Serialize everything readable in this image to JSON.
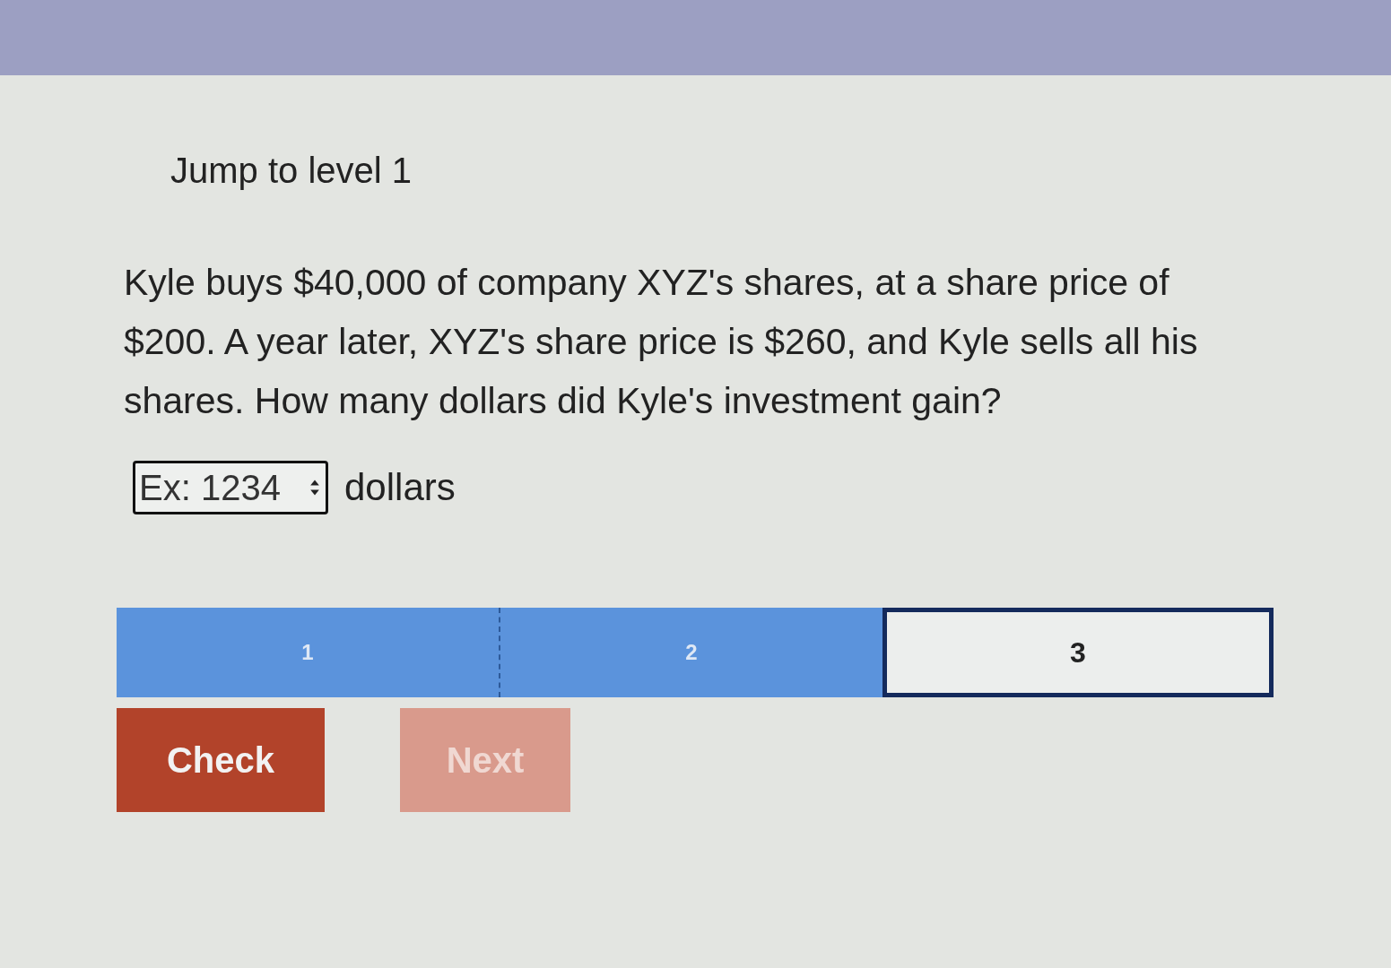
{
  "heading": "Jump to level 1",
  "question": "Kyle buys $40,000 of company XYZ's shares, at a share price of $200. A year later, XYZ's share price is $260, and Kyle sells all his shares. How many dollars did Kyle's investment gain?",
  "answer": {
    "placeholder": "Ex: 1234",
    "unit": "dollars"
  },
  "levels": [
    {
      "label": "1",
      "completed": true,
      "selected": false
    },
    {
      "label": "2",
      "completed": true,
      "selected": false
    },
    {
      "label": "3",
      "completed": false,
      "selected": true
    }
  ],
  "buttons": [
    {
      "label": "Check",
      "kind": "primary",
      "disabled": false
    },
    {
      "label": "Next",
      "kind": "primary",
      "disabled": true
    }
  ]
}
